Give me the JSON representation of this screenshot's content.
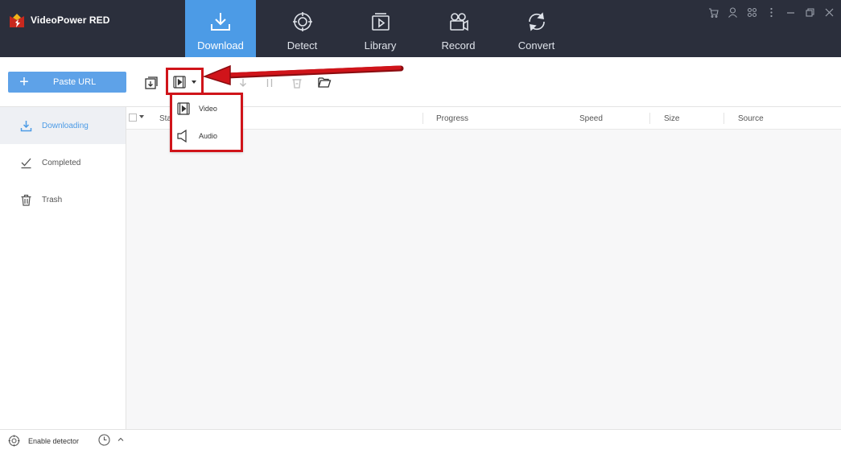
{
  "app": {
    "title": "VideoPower RED"
  },
  "nav": {
    "tabs": [
      {
        "label": "Download",
        "icon": "download-icon",
        "active": true
      },
      {
        "label": "Detect",
        "icon": "detect-icon",
        "active": false
      },
      {
        "label": "Library",
        "icon": "library-icon",
        "active": false
      },
      {
        "label": "Record",
        "icon": "record-icon",
        "active": false
      },
      {
        "label": "Convert",
        "icon": "convert-icon",
        "active": false
      }
    ]
  },
  "window_controls": [
    "cart-icon",
    "user-icon",
    "settings-icon",
    "more-icon",
    "minimize-icon",
    "restore-icon",
    "close-icon"
  ],
  "toolbar": {
    "paste_url_label": "Paste URL"
  },
  "sidebar": {
    "items": [
      {
        "label": "Downloading",
        "icon": "download-arrow-icon",
        "active": true
      },
      {
        "label": "Completed",
        "icon": "check-icon",
        "active": false
      },
      {
        "label": "Trash",
        "icon": "trash-icon",
        "active": false
      }
    ]
  },
  "table": {
    "columns": [
      "Sta",
      "Progress",
      "Speed",
      "Size",
      "Source"
    ]
  },
  "dropdown": {
    "items": [
      {
        "label": "Video",
        "icon": "video-file-icon"
      },
      {
        "label": "Audio",
        "icon": "speaker-icon"
      }
    ]
  },
  "statusbar": {
    "detector_label": "Enable detector"
  },
  "colors": {
    "topbar": "#2b2f3c",
    "accent": "#4c9be6",
    "paste_button": "#5ea2e8",
    "annotation_red": "#d0141a"
  }
}
